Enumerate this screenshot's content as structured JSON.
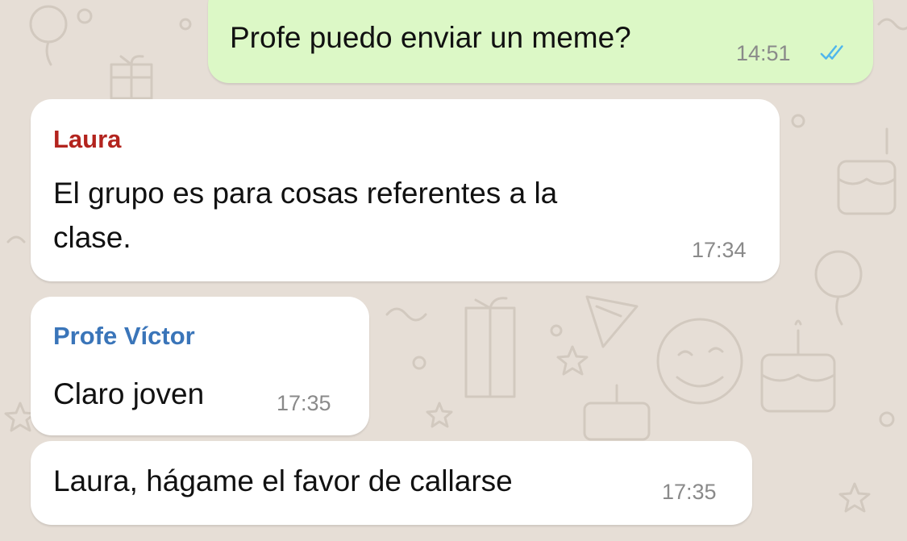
{
  "colors": {
    "outgoing_bubble": "#dcf8c6",
    "incoming_bubble": "#ffffff",
    "wallpaper": "#e6ded6",
    "read_ticks": "#4fb6ec",
    "timestamp": "#8a8a8a"
  },
  "chat": {
    "messages": [
      {
        "direction": "outgoing",
        "text": "Profe puedo enviar un meme?",
        "time": "14:51",
        "status_icon": "double-check-read-icon"
      },
      {
        "direction": "incoming",
        "sender": "Laura",
        "sender_color": "#b3241e",
        "text_line1": "El grupo es para cosas referentes a la",
        "text_line2": "clase.",
        "time": "17:34"
      },
      {
        "direction": "incoming",
        "sender": "Profe Víctor",
        "sender_color": "#3a75b9",
        "text": "Claro joven",
        "time": "17:35"
      },
      {
        "direction": "incoming",
        "text": "Laura, hágame el favor de callarse",
        "time": "17:35"
      }
    ]
  }
}
